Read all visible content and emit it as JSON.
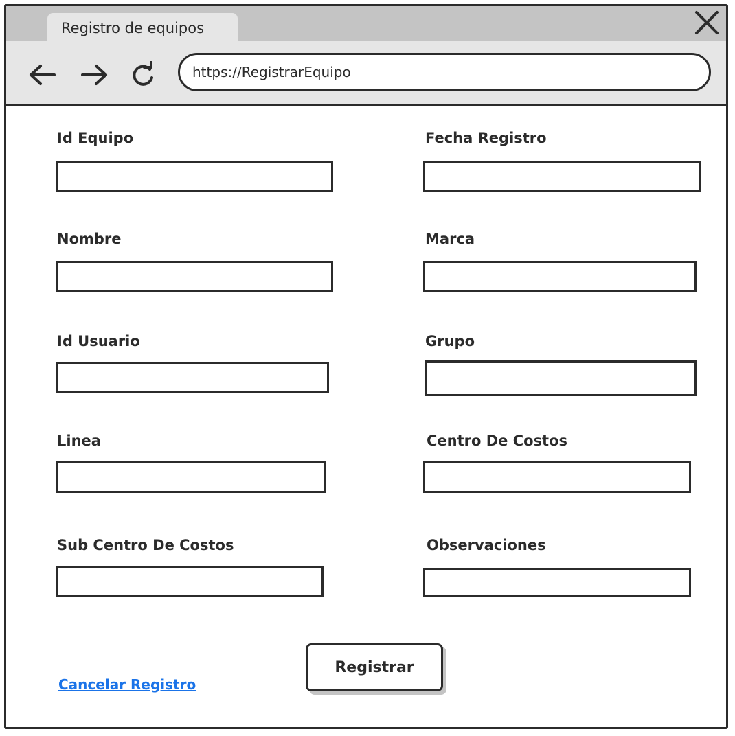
{
  "browser": {
    "tab_title": "Registro de equipos",
    "url": "https://RegistrarEquipo"
  },
  "icons": {
    "back": "arrow-left-icon",
    "forward": "arrow-right-icon",
    "reload": "reload-icon",
    "close": "close-icon"
  },
  "colors": {
    "tabstrip": "#c4c4c4",
    "chrome": "#e6e6e6",
    "stroke": "#2b2b2b",
    "link": "#1a73e8"
  },
  "form": {
    "fields": {
      "id_equipo": {
        "label": "Id Equipo",
        "value": ""
      },
      "fecha_registro": {
        "label": "Fecha Registro",
        "value": ""
      },
      "nombre": {
        "label": "Nombre",
        "value": ""
      },
      "marca": {
        "label": "Marca",
        "value": ""
      },
      "id_usuario": {
        "label": "Id Usuario",
        "value": ""
      },
      "grupo": {
        "label": "Grupo",
        "value": ""
      },
      "linea": {
        "label": "Linea",
        "value": ""
      },
      "centro_de_costos": {
        "label": "Centro De Costos",
        "value": ""
      },
      "sub_centro_de_costos": {
        "label": "Sub Centro De Costos",
        "value": ""
      },
      "observaciones": {
        "label": "Observaciones",
        "value": ""
      }
    },
    "submit_label": "Registrar",
    "cancel_label": "Cancelar Registro"
  }
}
